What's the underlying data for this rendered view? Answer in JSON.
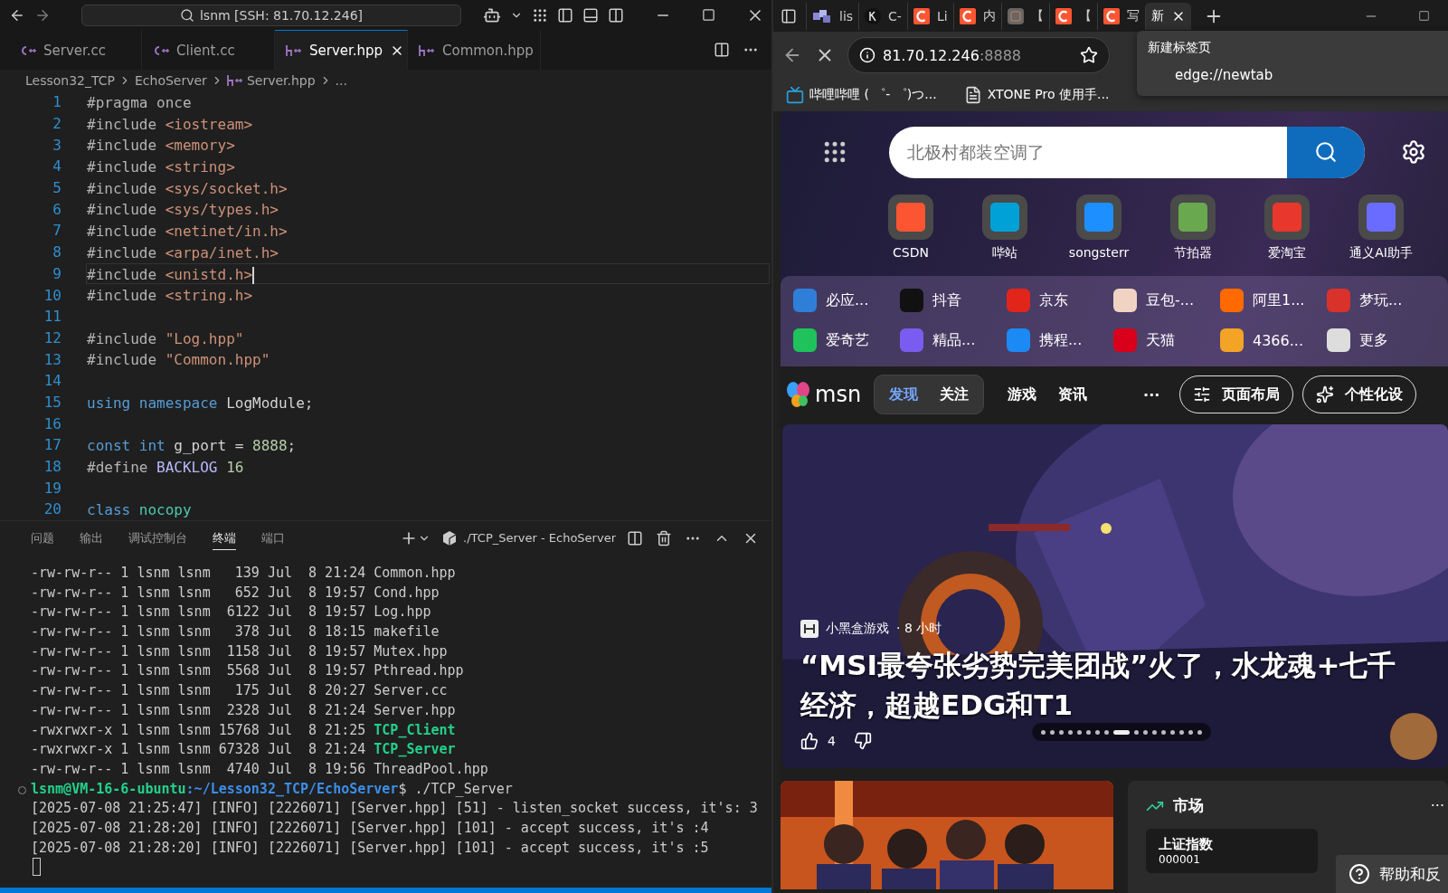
{
  "vscode": {
    "title": "lsnm [SSH: 81.70.12.246]",
    "tabs": [
      {
        "label": "Server.cc",
        "kind": "cpp",
        "selected": false
      },
      {
        "label": "Client.cc",
        "kind": "cpp",
        "selected": false
      },
      {
        "label": "Server.hpp",
        "kind": "hpp",
        "selected": true
      },
      {
        "label": "Common.hpp",
        "kind": "hpp",
        "selected": false
      }
    ],
    "breadcrumb": [
      {
        "label": "Lesson32_TCP",
        "kind": "folder"
      },
      {
        "label": "EchoServer",
        "kind": "folder"
      },
      {
        "label": "Server.hpp",
        "kind": "file"
      },
      {
        "label": "...",
        "kind": "more"
      }
    ],
    "code": [
      {
        "number": "1",
        "current": false,
        "tokens": [
          {
            "kind": "pre",
            "t": "#pragma once"
          }
        ]
      },
      {
        "number": "2",
        "current": false,
        "tokens": [
          {
            "kind": "pre",
            "t": "#include "
          },
          {
            "kind": "str",
            "t": "<iostream>"
          }
        ]
      },
      {
        "number": "3",
        "current": false,
        "tokens": [
          {
            "kind": "pre",
            "t": "#include "
          },
          {
            "kind": "str",
            "t": "<memory>"
          }
        ]
      },
      {
        "number": "4",
        "current": false,
        "tokens": [
          {
            "kind": "pre",
            "t": "#include "
          },
          {
            "kind": "str",
            "t": "<string>"
          }
        ]
      },
      {
        "number": "5",
        "current": false,
        "tokens": [
          {
            "kind": "pre",
            "t": "#include "
          },
          {
            "kind": "str",
            "t": "<sys/socket.h>"
          }
        ]
      },
      {
        "number": "6",
        "current": false,
        "tokens": [
          {
            "kind": "pre",
            "t": "#include "
          },
          {
            "kind": "str",
            "t": "<sys/types.h>"
          }
        ]
      },
      {
        "number": "7",
        "current": false,
        "tokens": [
          {
            "kind": "pre",
            "t": "#include "
          },
          {
            "kind": "str",
            "t": "<netinet/in.h>"
          }
        ]
      },
      {
        "number": "8",
        "current": false,
        "tokens": [
          {
            "kind": "pre",
            "t": "#include "
          },
          {
            "kind": "str",
            "t": "<arpa/inet.h>"
          }
        ]
      },
      {
        "number": "9",
        "current": true,
        "tokens": [
          {
            "kind": "pre",
            "t": "#include "
          },
          {
            "kind": "str",
            "t": "<unistd.h>"
          }
        ]
      },
      {
        "number": "10",
        "current": false,
        "tokens": [
          {
            "kind": "pre",
            "t": "#include "
          },
          {
            "kind": "str",
            "t": "<string.h>"
          }
        ]
      },
      {
        "number": "11",
        "current": false
      },
      {
        "number": "12",
        "current": false,
        "tokens": [
          {
            "kind": "pre",
            "t": "#include "
          },
          {
            "kind": "str",
            "t": "\"Log.hpp\""
          }
        ]
      },
      {
        "number": "13",
        "current": false,
        "tokens": [
          {
            "kind": "pre",
            "t": "#include "
          },
          {
            "kind": "str",
            "t": "\"Common.hpp\""
          }
        ]
      },
      {
        "number": "14",
        "current": false
      },
      {
        "number": "15",
        "current": false,
        "tokens": [
          {
            "kind": "kw",
            "t": "using namespace "
          },
          {
            "kind": "plain",
            "t": "LogModule;"
          }
        ]
      },
      {
        "number": "16",
        "current": false
      },
      {
        "number": "17",
        "current": false,
        "tokens": [
          {
            "kind": "kw",
            "t": "const int "
          },
          {
            "kind": "plain",
            "t": "g_port = "
          },
          {
            "kind": "num",
            "t": "8888"
          },
          {
            "kind": "plain",
            "t": ";"
          }
        ]
      },
      {
        "number": "18",
        "current": false,
        "tokens": [
          {
            "kind": "pre",
            "t": "#define "
          },
          {
            "kind": "macro",
            "t": "BACKLOG "
          },
          {
            "kind": "num",
            "t": "16"
          }
        ]
      },
      {
        "number": "19",
        "current": false
      },
      {
        "number": "20",
        "current": false,
        "tokens": [
          {
            "kind": "kw",
            "t": "class "
          },
          {
            "kind": "type",
            "t": "nocopy"
          }
        ]
      }
    ],
    "panel": {
      "tabs": [
        {
          "label": "问题",
          "selected": false
        },
        {
          "label": "输出",
          "selected": false
        },
        {
          "label": "调试控制台",
          "selected": false
        },
        {
          "label": "终端",
          "selected": true
        },
        {
          "label": "端口",
          "selected": false
        }
      ],
      "terminal_title": "./TCP_Server - EchoServer",
      "lines": [
        {
          "kind": "file",
          "text": "-rw-rw-r-- 1 lsnm lsnm   139 Jul  8 21:24 ",
          "name": "Common.hpp",
          "executable": false
        },
        {
          "kind": "file",
          "text": "-rw-rw-r-- 1 lsnm lsnm   652 Jul  8 19:57 ",
          "name": "Cond.hpp",
          "executable": false
        },
        {
          "kind": "file",
          "text": "-rw-rw-r-- 1 lsnm lsnm  6122 Jul  8 19:57 ",
          "name": "Log.hpp",
          "executable": false
        },
        {
          "kind": "file",
          "text": "-rw-rw-r-- 1 lsnm lsnm   378 Jul  8 18:15 ",
          "name": "makefile",
          "executable": false
        },
        {
          "kind": "file",
          "text": "-rw-rw-r-- 1 lsnm lsnm  1158 Jul  8 19:57 ",
          "name": "Mutex.hpp",
          "executable": false
        },
        {
          "kind": "file",
          "text": "-rw-rw-r-- 1 lsnm lsnm  5568 Jul  8 19:57 ",
          "name": "Pthread.hpp",
          "executable": false
        },
        {
          "kind": "file",
          "text": "-rw-rw-r-- 1 lsnm lsnm   175 Jul  8 20:27 ",
          "name": "Server.cc",
          "executable": false
        },
        {
          "kind": "file",
          "text": "-rw-rw-r-- 1 lsnm lsnm  2328 Jul  8 21:24 ",
          "name": "Server.hpp",
          "executable": false
        },
        {
          "kind": "file",
          "text": "-rwxrwxr-x 1 lsnm lsnm 15768 Jul  8 21:25 ",
          "name": "TCP_Client",
          "executable": true
        },
        {
          "kind": "file",
          "text": "-rwxrwxr-x 1 lsnm lsnm 67328 Jul  8 21:24 ",
          "name": "TCP_Server",
          "executable": true
        },
        {
          "kind": "file",
          "text": "-rw-rw-r-- 1 lsnm lsnm  4740 Jul  8 19:56 ",
          "name": "ThreadPool.hpp",
          "executable": false
        },
        {
          "kind": "prompt",
          "user": "lsnm@VM-16-6-ubuntu",
          "path": ":~/Lesson32_TCP/EchoServer",
          "command": "$ ./TCP_Server"
        },
        {
          "kind": "log",
          "text": "[2025-07-08 21:25:47] [INFO] [2226071] [Server.hpp] [51] - listen_socket success, it's: 3"
        },
        {
          "kind": "log",
          "text": "[2025-07-08 21:28:20] [INFO] [2226071] [Server.hpp] [101] - accept success, it's :4"
        },
        {
          "kind": "log",
          "text": "[2025-07-08 21:28:20] [INFO] [2226071] [Server.hpp] [101] - accept success, it's :5"
        }
      ]
    }
  },
  "browser": {
    "tabs": [
      {
        "label": "lis",
        "kind": "cubes",
        "selected": false
      },
      {
        "label": "C-",
        "kind": "k",
        "selected": false
      },
      {
        "label": "Li",
        "kind": "csdn",
        "selected": false
      },
      {
        "label": "内",
        "kind": "csdn",
        "selected": false
      },
      {
        "label": "【",
        "kind": "box",
        "selected": false
      },
      {
        "label": "【",
        "kind": "csdn",
        "selected": false
      },
      {
        "label": "写",
        "kind": "csdn",
        "selected": false
      },
      {
        "label": "新",
        "kind": "blank",
        "selected": true
      }
    ],
    "address": {
      "host": "81.70.12.246",
      "port": ":8888"
    },
    "tooltip": {
      "title": "新建标签页",
      "url": "edge://newtab"
    },
    "bookmarks": [
      {
        "label": "哔哩哔哩 ( ゜- ゜)つ...",
        "kind": "tv"
      },
      {
        "label": "XTONE Pro 使用手...",
        "kind": "doc"
      }
    ],
    "search": {
      "placeholder": "北极村都装空调了"
    },
    "shortcuts": [
      {
        "label": "CSDN",
        "color": "#fc5531"
      },
      {
        "label": "哔站",
        "color": "#00a1d6"
      },
      {
        "label": "songsterr",
        "color": "#1e8fff"
      },
      {
        "label": "节拍器",
        "color": "#6aa84f"
      },
      {
        "label": "爱淘宝",
        "color": "#e8372c"
      },
      {
        "label": "通义AI助手",
        "color": "#6a6cff"
      }
    ],
    "quick_links": [
      {
        "label": "必应...",
        "color": "#2f7fd8"
      },
      {
        "label": "抖音",
        "color": "#111111"
      },
      {
        "label": "京东",
        "color": "#e1251b"
      },
      {
        "label": "豆包-...",
        "color": "#f1d3c4"
      },
      {
        "label": "阿里1...",
        "color": "#ff6a00"
      },
      {
        "label": "梦玩...",
        "color": "#d8322a"
      },
      {
        "label": "爱奇艺",
        "color": "#1fc25b"
      },
      {
        "label": "精品...",
        "color": "#7b5cf0"
      },
      {
        "label": "携程...",
        "color": "#1c8af5"
      },
      {
        "label": "天猫",
        "color": "#d9001b"
      },
      {
        "label": "4366...",
        "color": "#f3a326"
      },
      {
        "label": "更多",
        "color": "#dddddd"
      }
    ],
    "msn": {
      "logo": "msn",
      "tabs": [
        {
          "label": "发现",
          "selected": true
        },
        {
          "label": "关注",
          "selected": false
        }
      ],
      "links": [
        "游戏",
        "资讯",
        "···"
      ],
      "buttons": [
        "页面布局",
        "个性化设"
      ]
    },
    "hero": {
      "source": "小黑盒游戏",
      "time": "· 8 小时",
      "headline": "“MSI最夸张劣势完美团战”火了，水龙魂+七千经济，超越EDG和T1",
      "likes": "4",
      "dots": [
        {
          "selected": false
        },
        {
          "selected": false
        },
        {
          "selected": false
        },
        {
          "selected": false
        },
        {
          "selected": false
        },
        {
          "selected": false
        },
        {
          "selected": false
        },
        {
          "selected": false
        },
        {
          "selected": true
        },
        {
          "selected": false
        },
        {
          "selected": false
        },
        {
          "selected": false
        },
        {
          "selected": false
        },
        {
          "selected": false
        },
        {
          "selected": false
        },
        {
          "selected": false
        },
        {
          "selected": false
        }
      ]
    },
    "market": {
      "title": "市场",
      "more": "···",
      "index_name": "上证指数",
      "index_code": "000001"
    },
    "help": "帮助和反"
  }
}
